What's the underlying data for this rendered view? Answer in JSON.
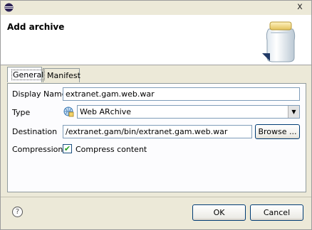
{
  "dialog": {
    "title": "Add archive",
    "close_glyph": "x"
  },
  "tabs": [
    {
      "label": "General",
      "active": true
    },
    {
      "label": "Manifest",
      "active": false
    }
  ],
  "form": {
    "display_name_label": "Display Name",
    "display_name_value": "extranet.gam.web.war",
    "type_label": "Type",
    "type_value": "Web ARchive",
    "destination_label": "Destination",
    "destination_value": "/extranet.gam/bin/extranet.gam.web.war",
    "browse_label": "Browse ...",
    "compression_label": "Compression",
    "compress_checkbox_label": "Compress content",
    "compress_checked": true,
    "check_glyph": "✔"
  },
  "footer": {
    "help_glyph": "?",
    "ok_label": "OK",
    "cancel_label": "Cancel"
  },
  "icons": {
    "app": "eclipse-icon",
    "banner": "jar-icon",
    "type": "web-archive-icon",
    "help": "help-icon"
  }
}
